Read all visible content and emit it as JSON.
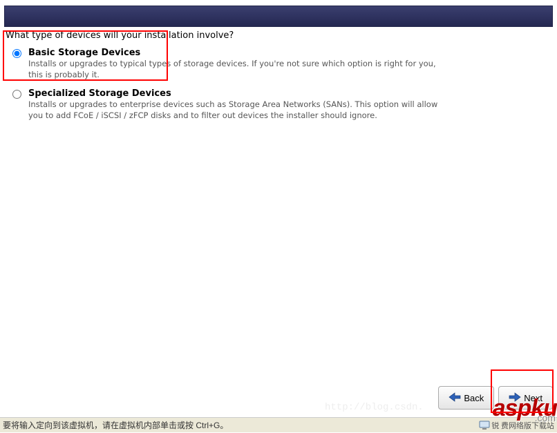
{
  "question": "What type of devices will your installation involve?",
  "options": [
    {
      "title": "Basic Storage Devices",
      "desc": "Installs or upgrades to typical types of storage devices.  If you're not sure which option is right for you, this is probably it.",
      "checked": true
    },
    {
      "title": "Specialized Storage Devices",
      "desc": "Installs or upgrades to enterprise devices such as Storage Area Networks (SANs). This option will allow you to add FCoE / iSCSI / zFCP disks and to filter out devices the installer should ignore.",
      "checked": false
    }
  ],
  "buttons": {
    "back": "Back",
    "next": "Next"
  },
  "status": "要将输入定向到该虚拟机，请在虚拟机内部单击或按 Ctrl+G。",
  "tray_text": "锐 费网络版下载站",
  "watermark": {
    "main": "aspku",
    "sub": ".com"
  },
  "ghost_url": "http://blog.csdn."
}
